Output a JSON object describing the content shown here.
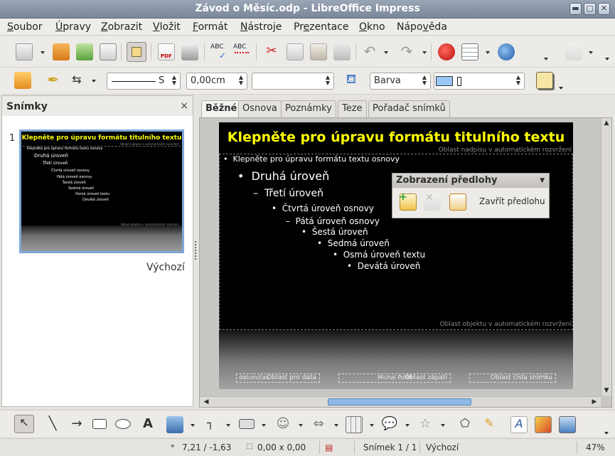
{
  "window": {
    "title": "Závod o Měsíc.odp - LibreOffice Impress"
  },
  "menu": {
    "items": [
      {
        "label": "Soubor",
        "mnemonic": "S"
      },
      {
        "label": "Úpravy",
        "mnemonic": "Ú"
      },
      {
        "label": "Zobrazit",
        "mnemonic": "Z"
      },
      {
        "label": "Vložit",
        "mnemonic": "V"
      },
      {
        "label": "Formát",
        "mnemonic": "F"
      },
      {
        "label": "Nástroje",
        "mnemonic": "N"
      },
      {
        "label": "Prezentace",
        "mnemonic": "e"
      },
      {
        "label": "Okno",
        "mnemonic": "O"
      },
      {
        "label": "Nápověda",
        "mnemonic": "v"
      }
    ]
  },
  "line_toolbar": {
    "line_style_value": "S",
    "line_width": "0,00cm",
    "line_color_value": "",
    "area_style": "Barva",
    "area_color_value": ""
  },
  "slides_pane": {
    "title": "Slides",
    "title_text": "Snímky",
    "close": "×",
    "slide_number": "1",
    "slide_caption": "Výchozí"
  },
  "thumbnail": {
    "title": "Klepněte pro úpravu formátu titulního textu",
    "title_area_label": "Oblast nadpisu v automatickém rozvržení",
    "lines": [
      "Klepněte pro úpravu formátu textu osnovy",
      "Druhá úroveň",
      "Třetí úroveň",
      "Čtvrtá úroveň osnovy",
      "Pátá úroveň osnovy",
      "Šestá úroveň",
      "Sedmá úroveň",
      "Osmá úroveň textu",
      "Devátá úroveň"
    ],
    "object_area_label": "Oblast objektu v automatickém rozvržení"
  },
  "tabs": [
    {
      "label": "Běžné",
      "active": true
    },
    {
      "label": "Osnova",
      "active": false
    },
    {
      "label": "Poznámky",
      "active": false
    },
    {
      "label": "Teze",
      "active": false
    },
    {
      "label": "Pořadač snímků",
      "active": false
    }
  ],
  "slide": {
    "title": "Klepněte pro úpravu formátu titulního textu",
    "title_area_label": "Oblast nadpisu v automatickém rozvržení",
    "outline": [
      "Klepněte pro úpravu formátu textu osnovy",
      "Druhá úroveň",
      "Třetí úroveň",
      "Čtvrtá úroveň osnovy",
      "Pátá úroveň osnovy",
      "Šestá úroveň",
      "Sedmá úroveň",
      "Osmá úroveň textu",
      "Devátá úroveň"
    ],
    "object_area_label": "Oblast objektu v automatickém rozvržení",
    "footer_date": "datum/čas",
    "footer_date_label": "Oblast pro data",
    "footer_text": "Michal Polák",
    "footer_text_label": "Oblast zápatí",
    "footer_number_label": "Oblast čísla snímku"
  },
  "master_toolbar": {
    "title": "Zobrazení předlohy",
    "close_master": "Zavřít předlohu"
  },
  "statusbar": {
    "position": "7,21 / -1,63",
    "size": "0,00 x 0,00",
    "slide": "Snímek 1 / 1",
    "layout": "Výchozí",
    "zoom": "47%"
  },
  "colors": {
    "title_yellow": "#ffff00",
    "slide_bg": "#000000",
    "thumb_border": "#7ea7d8",
    "titlebar": "#8894a7"
  }
}
